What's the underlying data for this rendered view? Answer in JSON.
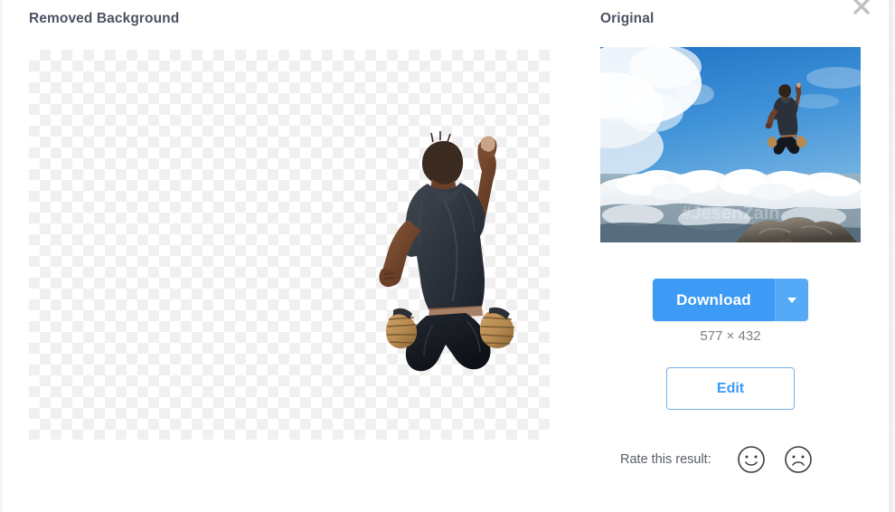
{
  "left_panel": {
    "title": "Removed Background",
    "canvas_name": "transparent-checkerboard-canvas",
    "subject_alt": "man jumping with raised fist, background removed"
  },
  "right_panel": {
    "title": "Original",
    "thumbnail_alt": "man jumping above clouds on a mountain top against blue sky",
    "watermark": "#JesenZain",
    "download": {
      "label": "Download",
      "dropdown_icon": "chevron-down-icon",
      "color": "#3d9bf5",
      "dropdown_color": "#55aaf7"
    },
    "dimensions": "577 × 432",
    "edit": {
      "label": "Edit",
      "border_color": "#74b3e8",
      "text_color": "#3d9bf5"
    },
    "rating": {
      "label": "Rate this result:",
      "positive_icon": "smiley-happy-icon",
      "negative_icon": "smiley-sad-icon"
    },
    "close_icon": "close-x-icon"
  },
  "theme": {
    "heading_color": "#4b5361",
    "muted_text": "#7c8086",
    "background": "#ffffff"
  }
}
